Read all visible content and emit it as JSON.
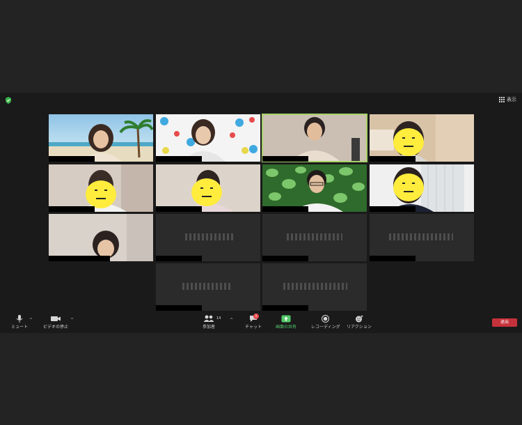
{
  "header": {
    "view_label": "表示"
  },
  "toolbar": {
    "mute_label": "ミュート",
    "video_label": "ビデオの停止",
    "participants_label": "参加者",
    "participants_count": "14",
    "chat_label": "チャット",
    "chat_badge": "1",
    "share_label": "画面の共有",
    "record_label": "レコーディング",
    "reaction_label": "リアクション",
    "leave_label": "退出",
    "caret": "^"
  },
  "colors": {
    "background": "#232323",
    "window": "#1a1a1a",
    "active_speaker_border": "#a8d26a",
    "share_green": "#53c96a",
    "leave_red": "#c6323b",
    "emoji_yellow": "#ffec3d"
  },
  "icons": [
    "shield-icon",
    "grid-icon",
    "microphone-icon",
    "video-camera-icon",
    "participants-icon",
    "chat-icon",
    "share-screen-icon",
    "record-icon",
    "reaction-icon",
    "smiley-face-icon"
  ]
}
